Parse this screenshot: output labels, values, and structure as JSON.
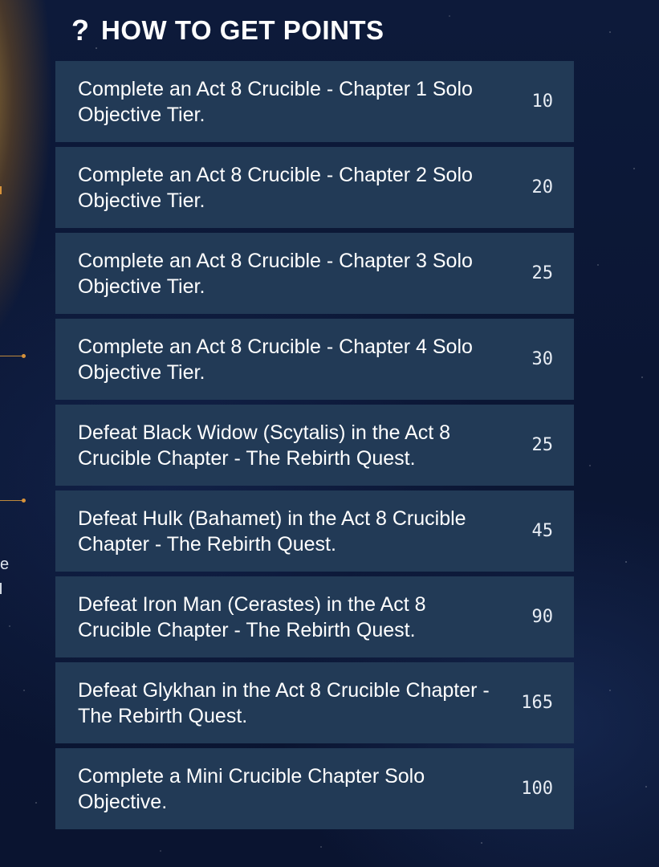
{
  "header": {
    "icon": "question-mark-icon",
    "icon_glyph": "?",
    "title": "HOW TO GET POINTS"
  },
  "sidebar_fragment": {
    "text": "e"
  },
  "colors": {
    "card_bg": "#223a56",
    "accent_line": "#d7923a",
    "text": "#ffffff"
  },
  "objectives": [
    {
      "text": "Complete an Act 8 Crucible - Chapter 1 Solo Objective Tier.",
      "points": "10"
    },
    {
      "text": "Complete an Act 8 Crucible - Chapter 2 Solo Objective Tier.",
      "points": "20"
    },
    {
      "text": "Complete an Act 8 Crucible - Chapter 3 Solo Objective Tier.",
      "points": "25"
    },
    {
      "text": "Complete an Act 8 Crucible - Chapter 4 Solo Objective Tier.",
      "points": "30"
    },
    {
      "text": "Defeat Black Widow (Scytalis) in the Act 8 Crucible Chapter - The Rebirth Quest.",
      "points": "25"
    },
    {
      "text": "Defeat Hulk (Bahamet) in the Act 8 Crucible Chapter - The Rebirth Quest.",
      "points": "45"
    },
    {
      "text": "Defeat Iron Man (Cerastes) in the Act 8 Crucible Chapter - The Rebirth Quest.",
      "points": "90"
    },
    {
      "text": "Defeat Glykhan in the Act 8 Crucible Chapter - The Rebirth Quest.",
      "points": "165"
    },
    {
      "text": "Complete a Mini Crucible Chapter Solo Objective.",
      "points": "100"
    }
  ]
}
